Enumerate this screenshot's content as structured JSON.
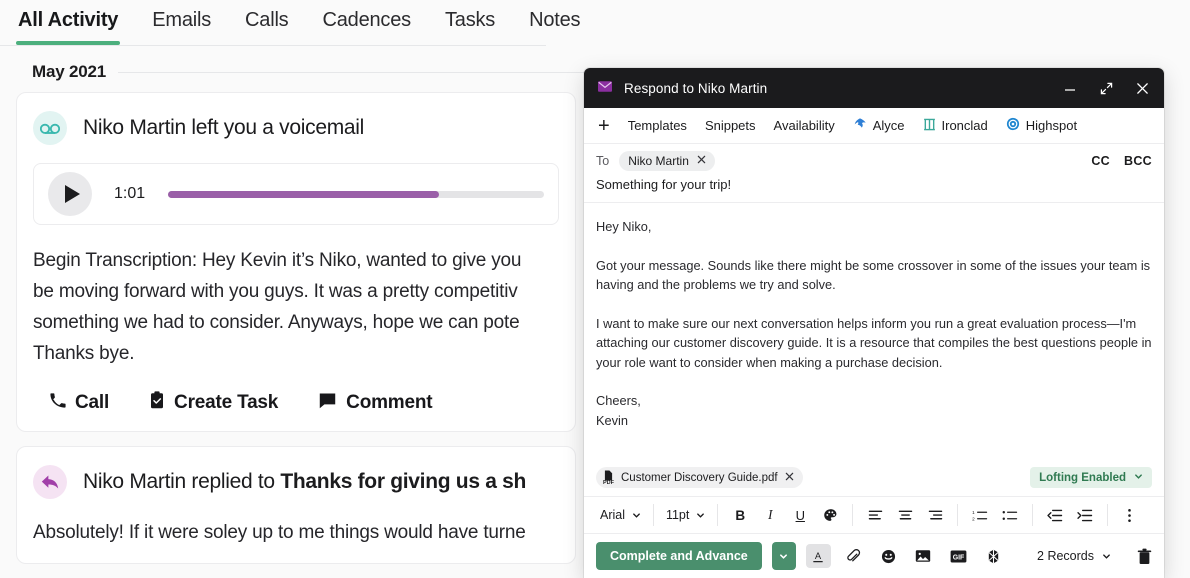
{
  "activity": {
    "tabs": [
      {
        "label": "All Activity",
        "active": true
      },
      {
        "label": "Emails",
        "active": false
      },
      {
        "label": "Calls",
        "active": false
      },
      {
        "label": "Cadences",
        "active": false
      },
      {
        "label": "Tasks",
        "active": false
      },
      {
        "label": "Notes",
        "active": false
      }
    ],
    "month_divider": "May 2021",
    "voicemail_card": {
      "icon": "voicemail-icon",
      "title": "Niko Martin left you a voicemail",
      "player": {
        "duration": "1:01",
        "progress_percent": 72,
        "play_icon": "play-icon",
        "progress_color": "#9a5fa8"
      },
      "transcript": "Begin Transcription: Hey Kevin it’s Niko, wanted to give you\nbe moving forward with you guys. It was a pretty competitiv\nsomething we had to consider. Anyways, hope we can pote\nThanks bye.",
      "actions": [
        {
          "label": "Call",
          "icon": "phone-icon"
        },
        {
          "label": "Create Task",
          "icon": "clipboard-check-icon"
        },
        {
          "label": "Comment",
          "icon": "comment-icon"
        }
      ]
    },
    "reply_card": {
      "icon": "reply-arrow-icon",
      "title_prefix": "Niko Martin replied to ",
      "title_subject": "Thanks for giving us a sh",
      "body": "Absolutely! If it were soley up to me things would have turne"
    }
  },
  "compose": {
    "window": {
      "icon": "envelope-icon",
      "title": "Respond to Niko Martin",
      "controls": [
        {
          "name": "minimize-icon"
        },
        {
          "name": "expand-icon"
        },
        {
          "name": "close-icon"
        }
      ]
    },
    "toolbar": {
      "add_label": "+",
      "items": [
        {
          "label": "Templates",
          "icon": null
        },
        {
          "label": "Snippets",
          "icon": null
        },
        {
          "label": "Availability",
          "icon": null
        },
        {
          "label": "Alyce",
          "icon": "alyce-icon",
          "color": "#2e7fd6"
        },
        {
          "label": "Ironclad",
          "icon": "ironclad-icon",
          "color": "#3ba89a"
        },
        {
          "label": "Highspot",
          "icon": "highspot-icon",
          "color": "#1f86d0"
        }
      ]
    },
    "to_row": {
      "label": "To",
      "recipient": "Niko Martin",
      "remove_icon": "close-icon",
      "cc_label": "CC",
      "bcc_label": "BCC"
    },
    "subject": "Something for your trip!",
    "body_paragraphs": [
      "Hey Niko,",
      "Got your message. Sounds like there might be some crossover in some of the issues your team is having and the problems we try and solve.",
      "I want to make sure our next conversation helps inform you run a great evaluation process—I'm attaching our customer discovery guide. It is a resource that compiles the best questions people in your role want to consider when making a purchase decision.",
      "Cheers,\nKevin"
    ],
    "attachment": {
      "icon": "pdf-file-icon",
      "badge": "PDF",
      "filename": "Customer Discovery Guide.pdf",
      "remove_icon": "close-icon"
    },
    "lofting": {
      "label": "Lofting Enabled",
      "caret_icon": "chevron-down-icon",
      "color": "#2f7a51",
      "background": "#e4f1e9"
    },
    "format_bar": {
      "font_family": "Arial",
      "font_size": "11pt",
      "font_caret_icon": "chevron-down-icon",
      "buttons": [
        {
          "name": "bold-icon",
          "glyph": "B"
        },
        {
          "name": "italic-icon",
          "glyph": "I"
        },
        {
          "name": "underline-icon",
          "glyph": "U"
        },
        {
          "name": "text-color-palette-icon",
          "glyph": "◑"
        },
        {
          "name": "align-left-icon"
        },
        {
          "name": "align-center-icon"
        },
        {
          "name": "align-right-icon"
        },
        {
          "name": "ordered-list-icon"
        },
        {
          "name": "bulleted-list-icon"
        },
        {
          "name": "outdent-icon"
        },
        {
          "name": "indent-icon"
        },
        {
          "name": "more-options-icon"
        }
      ]
    },
    "send_bar": {
      "primary_label": "Complete and Advance",
      "primary_caret_icon": "chevron-down-icon",
      "primary_color": "#4a8f6d",
      "tools": [
        {
          "name": "text-format-a-icon",
          "active": true
        },
        {
          "name": "attachment-paperclip-icon",
          "active": false
        },
        {
          "name": "emoji-icon",
          "active": false
        },
        {
          "name": "insert-image-icon",
          "active": false
        },
        {
          "name": "insert-gif-icon",
          "active": false
        },
        {
          "name": "insert-asset-icon",
          "active": false
        }
      ],
      "records_label": "2 Records",
      "records_caret_icon": "chevron-down-icon",
      "delete_icon": "trash-icon"
    }
  }
}
